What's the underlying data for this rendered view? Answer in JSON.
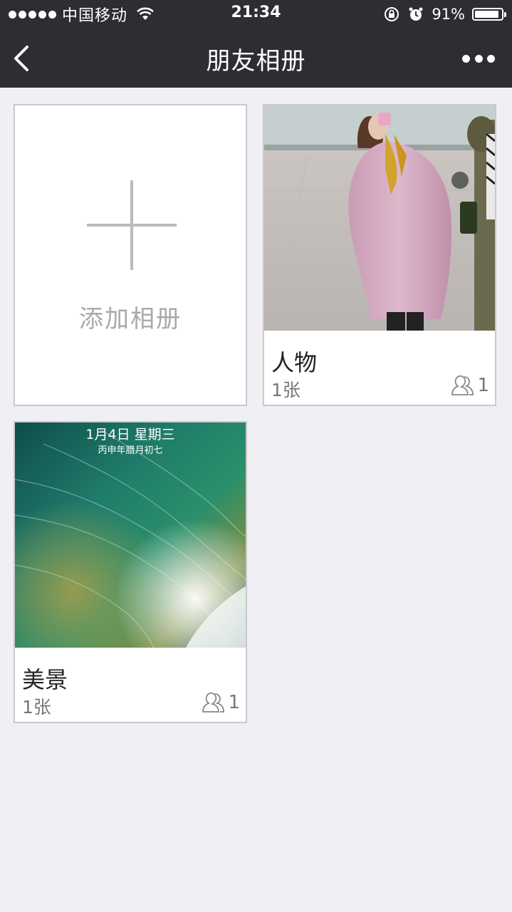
{
  "status_bar": {
    "carrier": "中国移动",
    "time": "21:34",
    "battery_percent": "91%",
    "battery_level": 0.91,
    "icons": [
      "signal-dots-icon",
      "wifi-icon",
      "rotation-lock-icon",
      "alarm-icon",
      "battery-icon"
    ]
  },
  "navbar": {
    "title": "朋友相册",
    "back_icon": "chevron-left-icon",
    "more_icon": "more-dots-icon"
  },
  "add_album": {
    "label": "添加相册",
    "icon": "plus-icon"
  },
  "albums": [
    {
      "name": "人物",
      "count": "1张",
      "members": "1",
      "cover": "person-in-pink-coat-photo"
    },
    {
      "name": "美景",
      "count": "1张",
      "members": "1",
      "cover": "ocean-wave-lockscreen-photo",
      "cover_date": "1月4日 星期三",
      "cover_lunar": "丙申年腊月初七"
    }
  ],
  "colors": {
    "bar_bg": "#2e2d32",
    "page_bg": "#efeff4",
    "card_border": "#c9c9cc"
  }
}
